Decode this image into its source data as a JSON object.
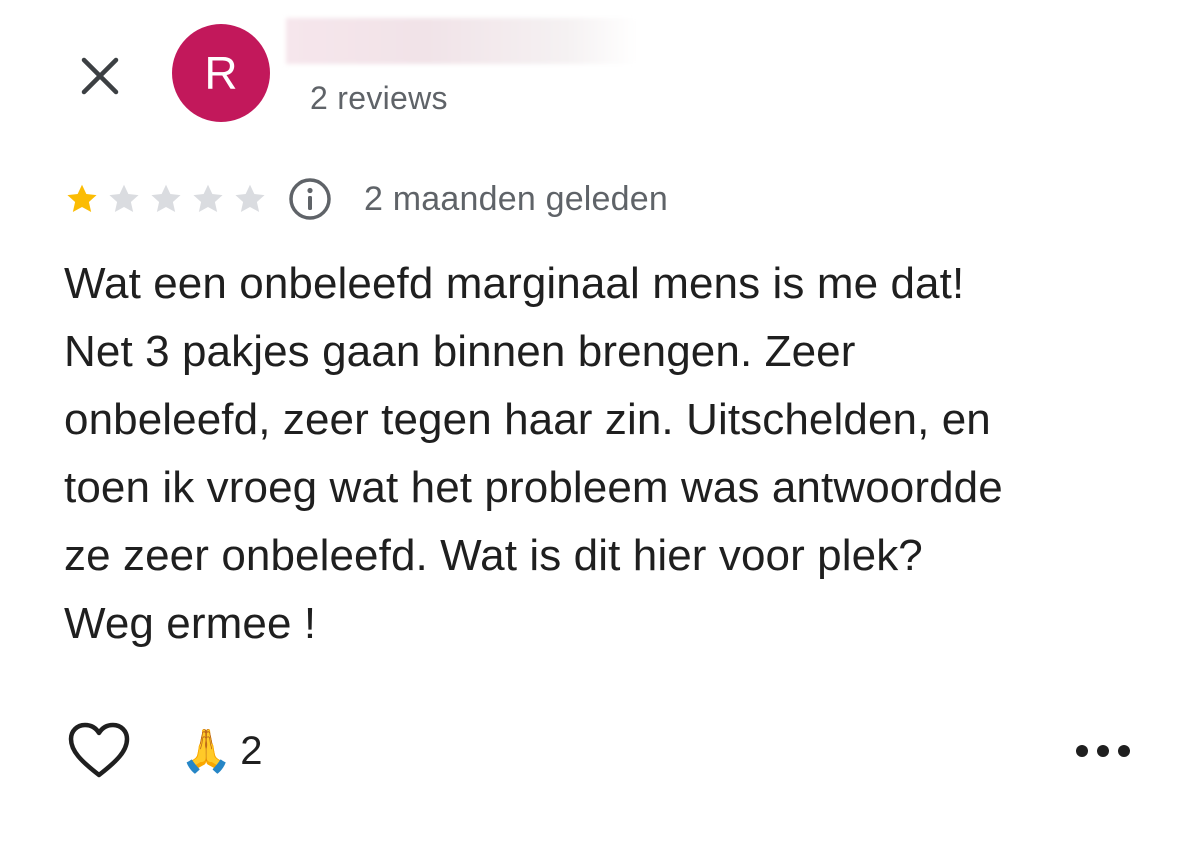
{
  "header": {
    "close_icon": "close-icon",
    "avatar_initial": "R",
    "avatar_color": "#c2185b",
    "reviews_count": "2 reviews"
  },
  "review": {
    "rating": 1,
    "max_rating": 5,
    "star_filled_color": "#fbbc04",
    "star_empty_color": "#dadce0",
    "time_ago": "2 maanden geleden",
    "text": "Wat een onbeleefd marginaal mens is me dat!\nNet 3 pakjes gaan binnen brengen. Zeer\nonbeleefd, zeer tegen haar zin. Uitschelden, en\ntoen ik vroeg wat het probleem was antwoordde\nze zeer onbeleefd. Wat is dit hier voor plek?\nWeg ermee !"
  },
  "actions": {
    "like_icon": "heart-outline-icon",
    "reaction_emoji": "🙏",
    "reaction_count": "2",
    "more_icon": "more-horizontal-icon"
  }
}
